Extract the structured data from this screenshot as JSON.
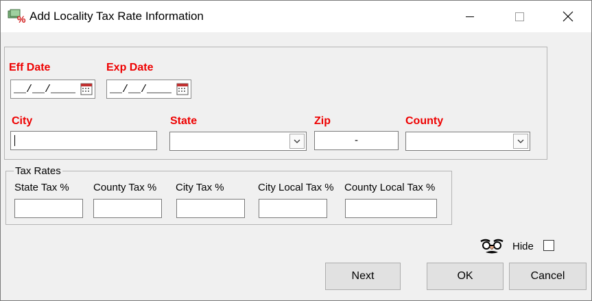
{
  "window": {
    "title": "Add Locality Tax Rate Information",
    "controls": [
      "minimize-icon",
      "maximize-icon",
      "close-icon"
    ]
  },
  "dates": {
    "eff_label": "Eff Date",
    "exp_label": "Exp Date",
    "eff_value": "__/__/____",
    "exp_value": "__/__/____"
  },
  "location": {
    "city_label": "City",
    "state_label": "State",
    "zip_label": "Zip",
    "county_label": "County",
    "city_value": "",
    "state_value": "",
    "zip_value": "-",
    "county_value": ""
  },
  "tax_rates": {
    "legend": "Tax Rates",
    "state_label": "State Tax %",
    "county_label": "County Tax %",
    "city_label": "City Tax %",
    "city_local_label": "City Local Tax %",
    "county_local_label": "County Local Tax %",
    "state_value": "",
    "county_value": "",
    "city_value": "",
    "city_local_value": "",
    "county_local_value": ""
  },
  "hide": {
    "label": "Hide",
    "checked": false,
    "icon": "disguise-glasses-icon"
  },
  "buttons": {
    "next": "Next",
    "ok": "OK",
    "cancel": "Cancel"
  },
  "colors": {
    "required_label": "#ee0000",
    "window_bg": "#f0f0f0",
    "titlebar_bg": "#ffffff"
  }
}
